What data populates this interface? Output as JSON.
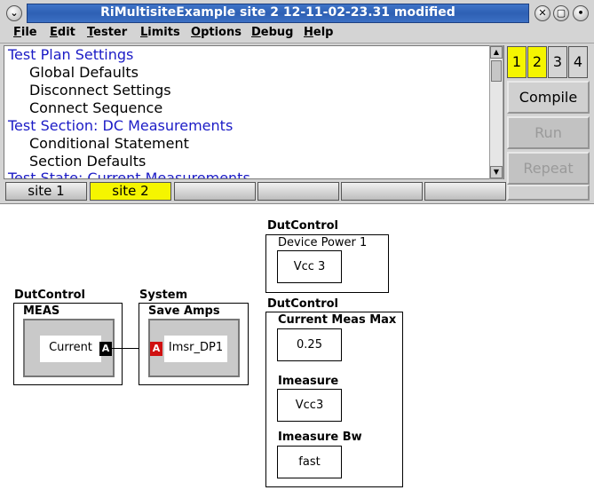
{
  "window": {
    "title": "RiMultisiteExample  site 2 12-11-02-23.31  modified"
  },
  "menu": [
    "File",
    "Edit",
    "Tester",
    "Limits",
    "Options",
    "Debug",
    "Help"
  ],
  "tree": [
    {
      "text": "Test Plan Settings",
      "kind": "section"
    },
    {
      "text": "Global Defaults",
      "kind": "child"
    },
    {
      "text": "Disconnect Settings",
      "kind": "child"
    },
    {
      "text": "Connect Sequence",
      "kind": "child"
    },
    {
      "text": "Test Section: DC Measurements",
      "kind": "section"
    },
    {
      "text": "Conditional Statement",
      "kind": "child"
    },
    {
      "text": "Section Defaults",
      "kind": "child"
    },
    {
      "text": "Test State: Current Measurements",
      "kind": "section"
    }
  ],
  "site_numbers": [
    {
      "label": "1",
      "active": true
    },
    {
      "label": "2",
      "active": true
    },
    {
      "label": "3",
      "active": false
    },
    {
      "label": "4",
      "active": false
    }
  ],
  "side_buttons": {
    "compile": "Compile",
    "run": "Run",
    "repeat": "Repeat"
  },
  "tabs": [
    {
      "label": "site 1",
      "active": false
    },
    {
      "label": "site 2",
      "active": true
    },
    {
      "label": "",
      "active": false
    },
    {
      "label": "",
      "active": false
    },
    {
      "label": "",
      "active": false
    },
    {
      "label": "",
      "active": false
    }
  ],
  "diagram": {
    "meas": {
      "group": "DutControl",
      "title": "MEAS",
      "value": "Current",
      "badge": "A"
    },
    "save_amps": {
      "group": "System",
      "title": "Save  Amps",
      "value": "Imsr_DP1",
      "badge": "A"
    },
    "device_power": {
      "group": "DutControl",
      "title": "Device Power 1",
      "value": "Vcc 3"
    },
    "current_meas": {
      "group": "DutControl",
      "fields": [
        {
          "label": "Current Meas Max",
          "value": "0.25"
        },
        {
          "label": "Imeasure",
          "value": "Vcc3"
        },
        {
          "label": "Imeasure Bw",
          "value": "fast"
        }
      ]
    }
  },
  "colors": {
    "title_bar": "#2e60b4",
    "active_yellow": "#f5f500",
    "section_blue": "#1b1bc6",
    "badge_black": "#000000",
    "badge_red": "#d01010"
  }
}
